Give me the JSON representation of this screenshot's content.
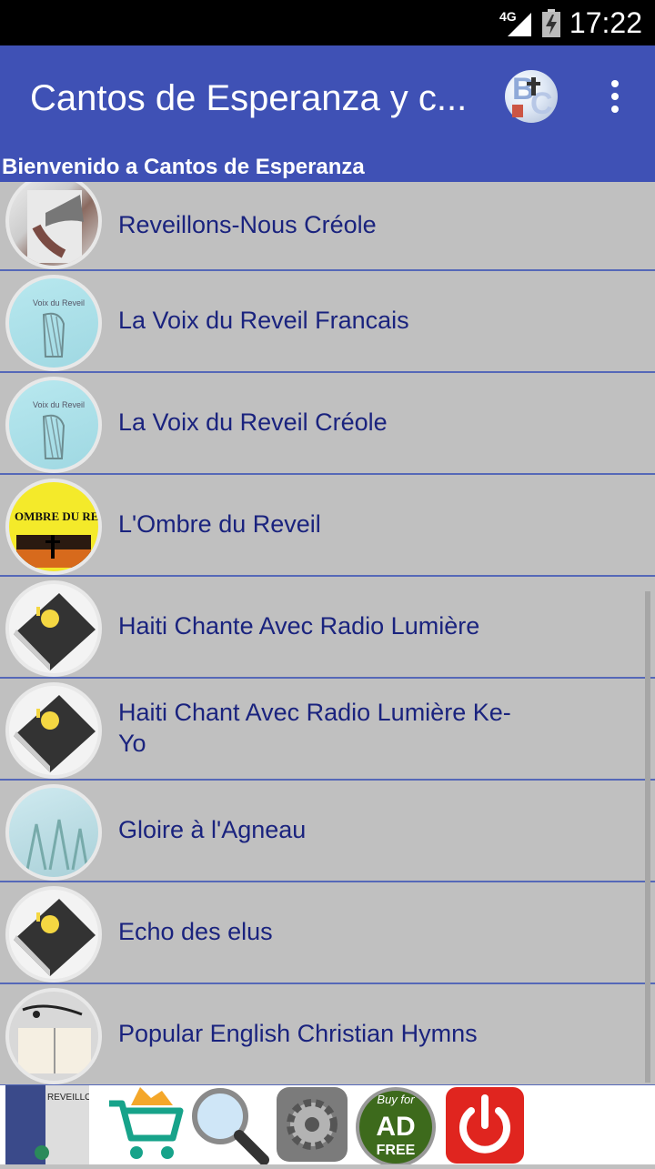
{
  "status_bar": {
    "network": "4G",
    "time": "17:22"
  },
  "app_bar": {
    "title": "Cantos de Esperanza y c...",
    "logo_letters": [
      "B",
      "C"
    ]
  },
  "welcome": "Bienvenido a Cantos de Esperanza",
  "list": {
    "items": [
      {
        "label": "Reveillons-Nous Créole",
        "thumb": "trumpet-image"
      },
      {
        "label": "La Voix du Reveil Francais",
        "thumb": "harp-cover-image",
        "thumb_text": "Voix du Reveil"
      },
      {
        "label": "La Voix du Reveil Créole",
        "thumb": "harp-cover-image",
        "thumb_text": "Voix du Reveil"
      },
      {
        "label": "L'Ombre du Reveil",
        "thumb": "ombre-cover-image",
        "thumb_text": "OMBRE DU REVEIL"
      },
      {
        "label": "Haiti Chante Avec Radio Lumière",
        "thumb": "bible-icon"
      },
      {
        "label": "Haiti Chant Avec Radio Lumière  Ke-Yo",
        "thumb": "bible-icon"
      },
      {
        "label": "Gloire à l'Agneau",
        "thumb": "gloire-cover-image"
      },
      {
        "label": "Echo des elus",
        "thumb": "bible-icon"
      },
      {
        "label": "Popular English Christian Hymns",
        "thumb": "hymnal-image"
      }
    ]
  },
  "bottom_bar": {
    "buttons": [
      {
        "name": "home-app-icon",
        "text": "REVEILLONS Nous"
      },
      {
        "name": "shop-cart-icon"
      },
      {
        "name": "search-icon"
      },
      {
        "name": "settings-gear-icon"
      },
      {
        "name": "buy-ad-free-icon",
        "text": "Buy for AD FREE"
      },
      {
        "name": "power-exit-icon"
      }
    ]
  },
  "colors": {
    "primary": "#3f51b5",
    "list_bg": "#c0c0c0",
    "label_text": "#1a237e",
    "divider": "#5568b8"
  }
}
